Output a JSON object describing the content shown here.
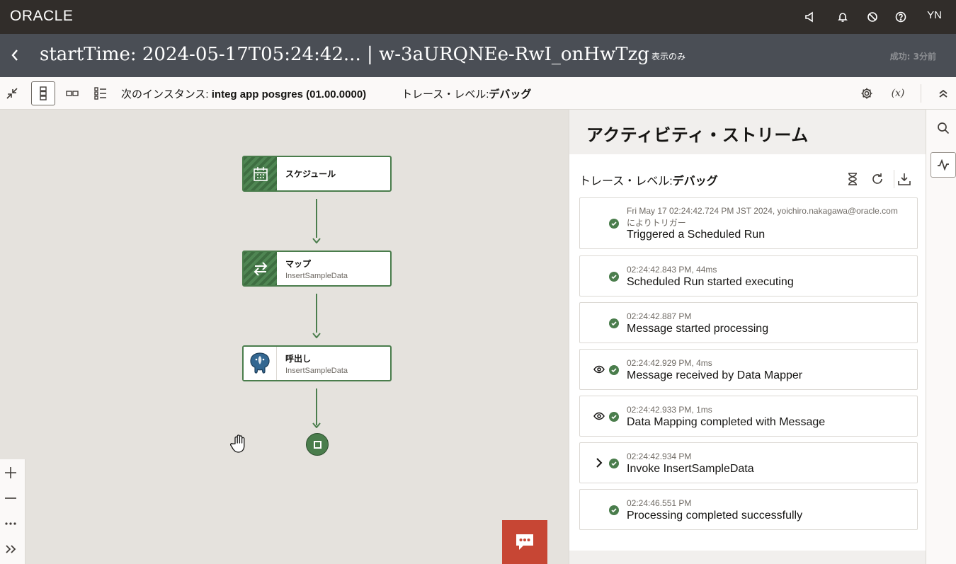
{
  "topbar": {
    "logo": "ORACLE",
    "initials": "YN",
    "icons": [
      "announcement-icon",
      "bell-icon",
      "no-entry-icon",
      "help-icon"
    ]
  },
  "titlebar": {
    "title": "startTime: 2024-05-17T05:24:42... | w-3aURQNEe-RwI_onHwTzg",
    "view_only": "表示のみ",
    "status": "成功: 3分前"
  },
  "toolbar": {
    "next_instance_label": "次のインスタンス:",
    "next_instance_value": "integ app posgres (01.00.0000)",
    "trace_label": "トレース・レベル:",
    "trace_value": "デバッグ",
    "variable_label": "(x)"
  },
  "flow": {
    "nodes": [
      {
        "title": "スケジュール",
        "subtitle": "",
        "icon": "calendar-icon"
      },
      {
        "title": "マップ",
        "subtitle": "InsertSampleData",
        "icon": "swap-arrows-icon"
      },
      {
        "title": "呼出し",
        "subtitle": "InsertSampleData",
        "icon": "postgresql-elephant-icon"
      }
    ],
    "end_icon": "stop-icon"
  },
  "activity": {
    "title": "アクティビティ・ストリーム",
    "trace_label": "トレース・レベル:",
    "trace_value": "デバッグ",
    "entries": [
      {
        "meta": "Fri May 17 02:24:42.724 PM JST 2024, yoichiro.nakagawa@oracle.com",
        "meta2": "によりトリガー",
        "message": "Triggered a Scheduled Run",
        "lead": ""
      },
      {
        "meta": "02:24:42.843 PM, 44ms",
        "meta2": "",
        "message": "Scheduled Run started executing",
        "lead": ""
      },
      {
        "meta": "02:24:42.887 PM",
        "meta2": "",
        "message": "Message started processing",
        "lead": ""
      },
      {
        "meta": "02:24:42.929 PM, 4ms",
        "meta2": "",
        "message": "Message received by Data Mapper",
        "lead": "eye-icon"
      },
      {
        "meta": "02:24:42.933 PM, 1ms",
        "meta2": "",
        "message": "Data Mapping completed with Message",
        "lead": "eye-icon"
      },
      {
        "meta": "02:24:42.934 PM",
        "meta2": "",
        "message": "Invoke InsertSampleData",
        "lead": "chevron-right-icon"
      },
      {
        "meta": "02:24:46.551 PM",
        "meta2": "",
        "message": "Processing completed successfully",
        "lead": ""
      }
    ]
  },
  "colors": {
    "topbar": "#312d2a",
    "titlebar": "#4a4e55",
    "accent_green": "#4a7d4c",
    "chat_red": "#c74634"
  }
}
